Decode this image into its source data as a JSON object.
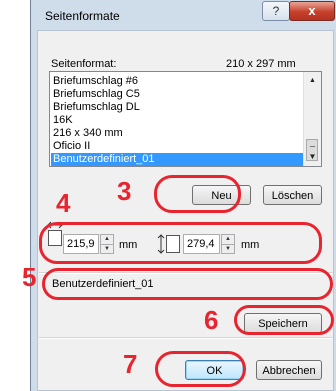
{
  "dialog": {
    "title": "Seitenformate",
    "help_glyph": "?",
    "close_glyph": "x"
  },
  "format_label": "Seitenformat:",
  "current_size": "210 x 297 mm",
  "paper_list": [
    {
      "label": "Briefumschlag #6",
      "selected": false
    },
    {
      "label": "Briefumschlag C5",
      "selected": false
    },
    {
      "label": "Briefumschlag DL",
      "selected": false
    },
    {
      "label": "16K",
      "selected": false
    },
    {
      "label": "216 x 340 mm",
      "selected": false
    },
    {
      "label": "Oficio II",
      "selected": false
    },
    {
      "label": "Benutzerdefiniert_01",
      "selected": true
    }
  ],
  "buttons": {
    "new": "Neu",
    "delete": "Löschen",
    "save": "Speichern",
    "ok": "OK",
    "cancel": "Abbrechen"
  },
  "dimensions": {
    "width_value": "215,9",
    "width_unit": "mm",
    "height_value": "279,4",
    "height_unit": "mm"
  },
  "name_field_value": "Benutzerdefiniert_01",
  "callouts": [
    "3",
    "4",
    "5",
    "6",
    "7"
  ],
  "colors": {
    "highlight": "#e8242f",
    "selection": "#3399ff",
    "titlebar": "#cfdcea"
  },
  "icons": {
    "width": "width-arrow-icon",
    "height": "height-arrow-icon"
  }
}
